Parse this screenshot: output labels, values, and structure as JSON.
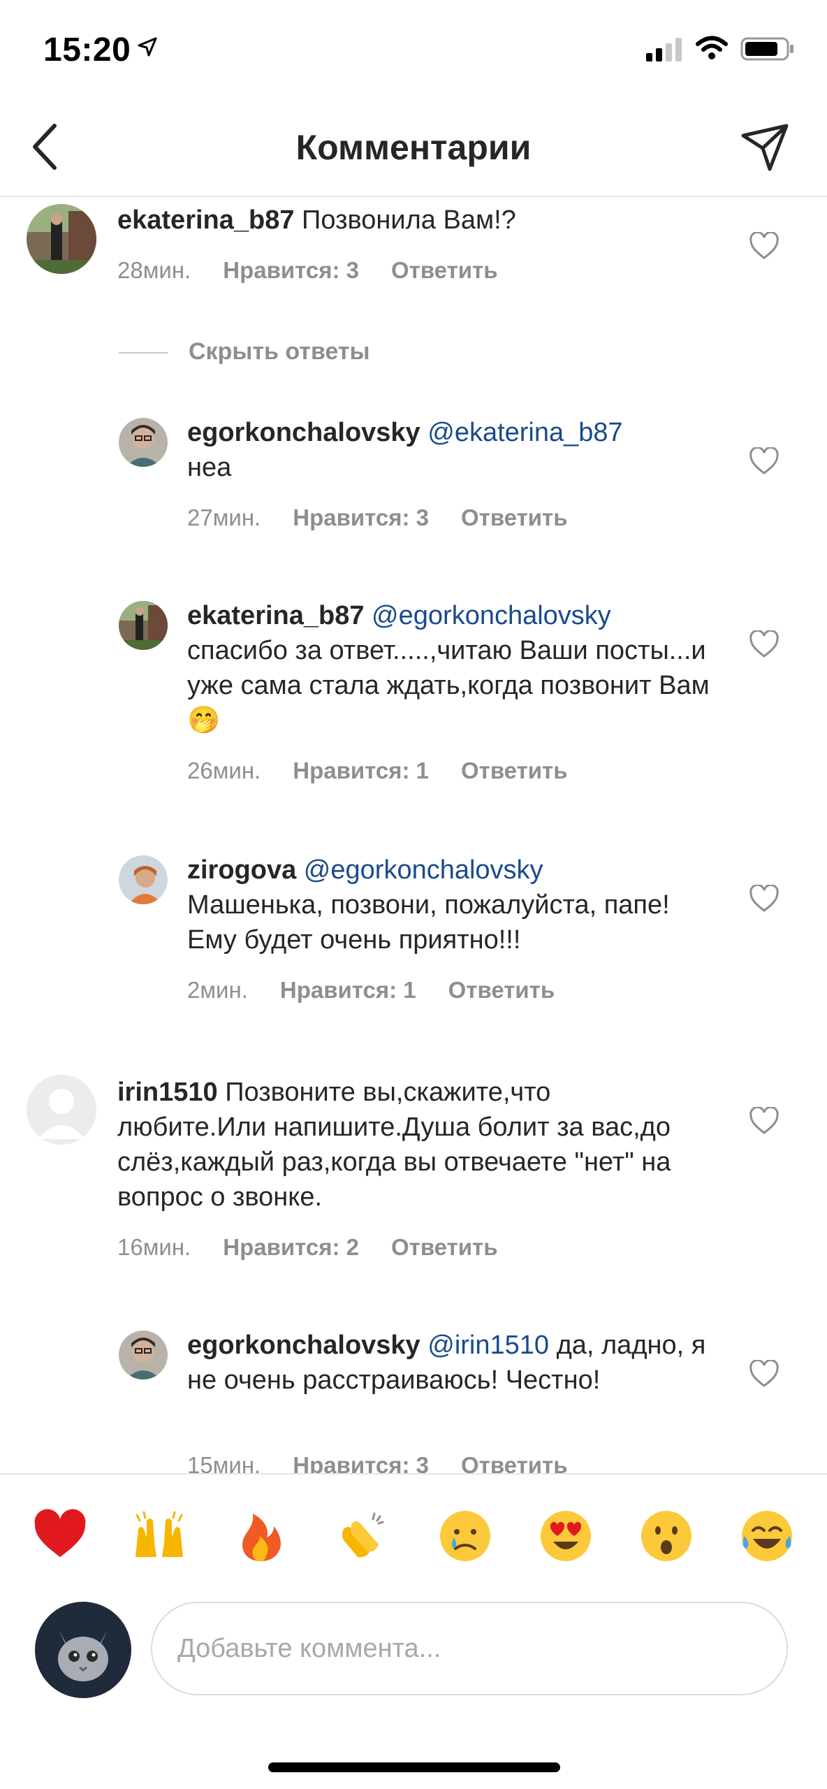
{
  "status": {
    "time": "15:20"
  },
  "header": {
    "title": "Комментарии",
    "back_icon": "chevron-left-icon",
    "share_icon": "paper-plane-icon"
  },
  "comments": [
    {
      "user": "ekaterina_b87",
      "mention": "",
      "text": " Позвонила Вам!?",
      "time": "28мин.",
      "likes": "Нравится: 3",
      "reply": "Ответить"
    },
    {
      "user": "egorkonchalovsky",
      "mention": " @ekaterina_b87",
      "text": "неа",
      "time": "27мин.",
      "likes": "Нравится: 3",
      "reply": "Ответить"
    },
    {
      "user": "ekaterina_b87",
      "mention": " @egorkonchalovsky",
      "text": "спасибо за ответ.....,читаю Ваши посты...и уже сама стала ждать,когда позвонит Вам",
      "emoji": "🤭",
      "time": "26мин.",
      "likes": "Нравится: 1",
      "reply": "Ответить"
    },
    {
      "user": "zirogova",
      "mention": " @egorkonchalovsky",
      "text": "Машенька, позвони, пожалуйста, папе! Ему будет очень приятно!!!",
      "time": "2мин.",
      "likes": "Нравится: 1",
      "reply": "Ответить"
    },
    {
      "user": "irin1510",
      "mention": "",
      "text": " Позвоните вы,скажите,что любите.Или напишите.Душа болит за вас,до слёз,каждый раз,когда вы отвечаете \"нет\" на вопрос о звонке.",
      "time": "16мин.",
      "likes": "Нравится: 2",
      "reply": "Ответить"
    },
    {
      "user": "egorkonchalovsky",
      "mention": " @irin1510",
      "text": " да, ладно, я не очень расстраиваюсь! Честно!",
      "time": "15мин.",
      "likes": "Нравится: 3",
      "reply": "Ответить"
    }
  ],
  "hide_replies": "Скрыть ответы",
  "emojis": [
    "❤️",
    "🙌",
    "🔥",
    "👏",
    "😢",
    "😍",
    "😮",
    "😂"
  ],
  "input": {
    "placeholder": "Добавьте коммента..."
  },
  "colors": {
    "mention": "#1b4a8c",
    "meta": "#8e8e8e",
    "text": "#262626"
  }
}
